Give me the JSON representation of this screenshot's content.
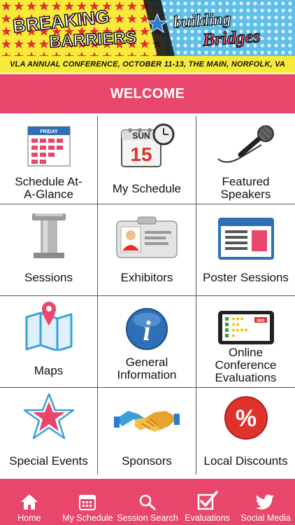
{
  "banner": {
    "left_title_1": "BREAKING",
    "left_title_2": "BARRIERS",
    "right_title_1": "building",
    "right_title_2": "Bridges",
    "subtitle": "VLA ANNUAL CONFERENCE, OCTOBER 11-13, THE MAIN, NORFOLK, VA",
    "colors": {
      "yellow": "#f7ea3a",
      "red": "#e0322d",
      "blue": "#4fb0e0",
      "dark": "#1a1a1a"
    }
  },
  "header": {
    "title": "WELCOME"
  },
  "icons": {
    "calendar_header": "FRIDAY",
    "my_schedule_day": "SUN",
    "my_schedule_date": "15",
    "evaluation_badge": "NMS"
  },
  "grid": {
    "items": [
      {
        "label": "Schedule At-A-Glance",
        "icon": "calendar-icon"
      },
      {
        "label": "My Schedule",
        "icon": "calendar-clock-icon"
      },
      {
        "label": "Featured Speakers",
        "icon": "microphone-icon"
      },
      {
        "label": "Sessions",
        "icon": "podium-icon"
      },
      {
        "label": "Exhibitors",
        "icon": "id-badge-icon"
      },
      {
        "label": "Poster Sessions",
        "icon": "poster-icon"
      },
      {
        "label": "Maps",
        "icon": "map-pin-icon"
      },
      {
        "label": "General Information",
        "icon": "info-icon"
      },
      {
        "label": "Online Conference Evaluations",
        "icon": "tablet-checklist-icon"
      },
      {
        "label": "Special Events",
        "icon": "star-icon"
      },
      {
        "label": "Sponsors",
        "icon": "handshake-icon"
      },
      {
        "label": "Local Discounts",
        "icon": "percent-icon"
      }
    ]
  },
  "tabbar": {
    "items": [
      {
        "label": "Home",
        "icon": "home-icon"
      },
      {
        "label": "My Schedule",
        "icon": "calendar-icon"
      },
      {
        "label": "Session Search",
        "icon": "search-icon"
      },
      {
        "label": "Evaluations",
        "icon": "checkbox-icon"
      },
      {
        "label": "Social Media",
        "icon": "twitter-bird-icon"
      }
    ]
  },
  "theme": {
    "accent": "#e8476b",
    "cell_border": "#555555"
  }
}
